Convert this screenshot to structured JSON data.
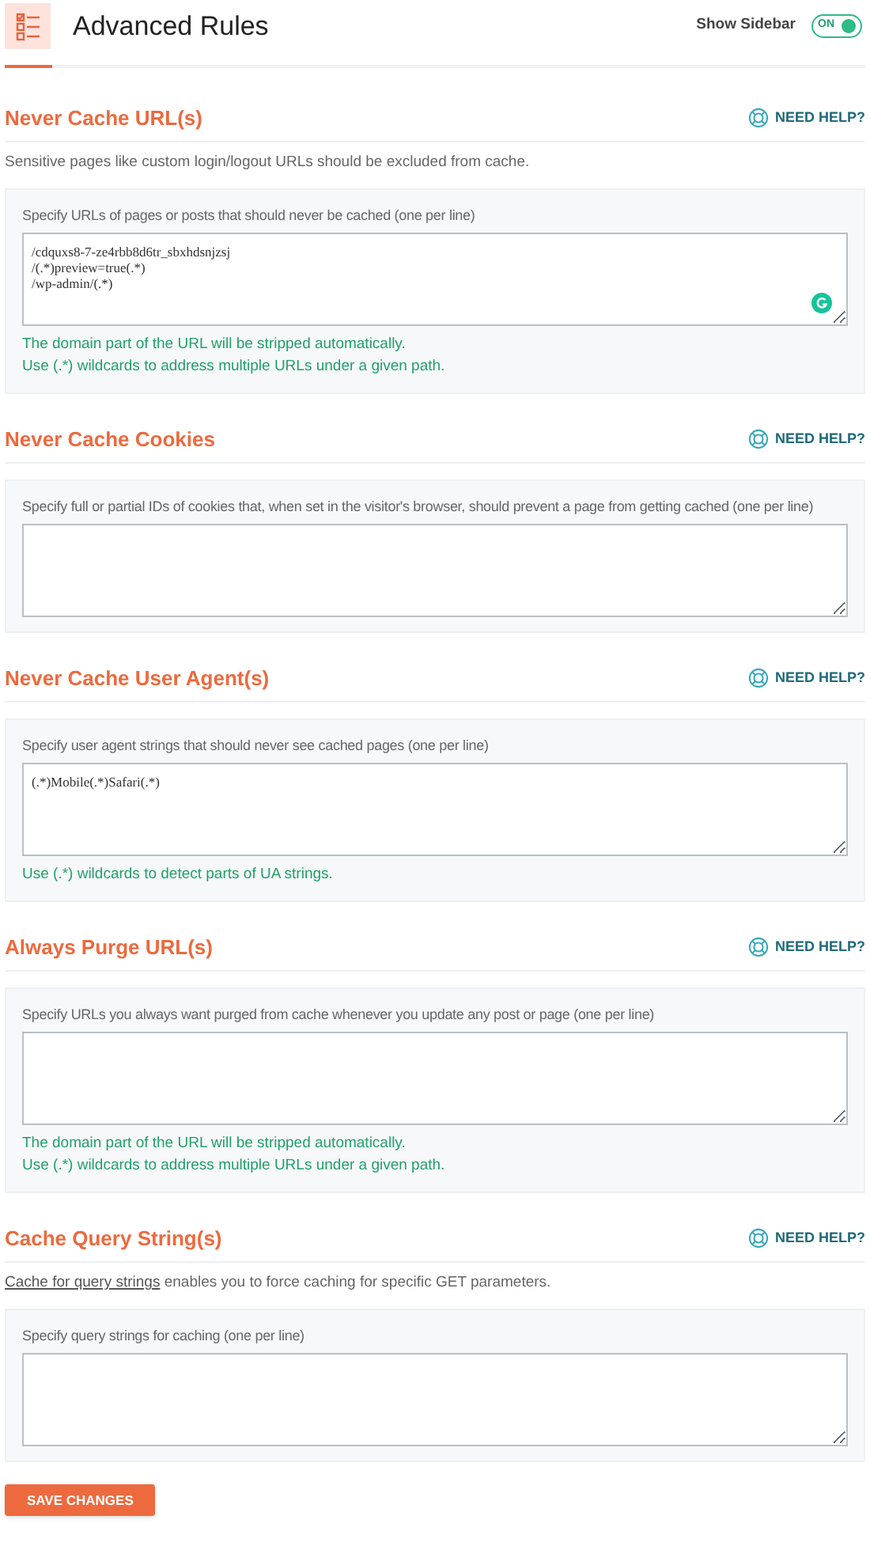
{
  "header": {
    "title": "Advanced Rules",
    "sidebar_toggle": {
      "label": "Show Sidebar",
      "state_text": "ON",
      "on": true
    }
  },
  "sections": [
    {
      "title": "Never Cache URL(s)",
      "help": "NEED HELP?",
      "description": "Sensitive pages like custom login/logout URLs should be excluded from cache.",
      "field_label": "Specify URLs of pages or posts that should never be cached (one per line)",
      "value": "/cdquxs8-7-ze4rbb8d6tr_sbxhdsnjzsj\n/(.*)preview=true(.*)\n/wp-admin/(.*)",
      "grammar_badge": true,
      "notes": [
        "The domain part of the URL will be stripped automatically.",
        "Use (.*) wildcards to address multiple URLs under a given path."
      ]
    },
    {
      "title": "Never Cache Cookies",
      "help": "NEED HELP?",
      "field_label": "Specify full or partial IDs of cookies that, when set in the visitor's browser, should prevent a page from getting cached (one per line)"
    },
    {
      "title": "Never Cache User Agent(s)",
      "help": "NEED HELP?",
      "field_label": "Specify user agent strings that should never see cached pages (one per line)",
      "value": "(.*)Mobile(.*)Safari(.*)",
      "notes": [
        "Use (.*) wildcards to detect parts of UA strings."
      ]
    },
    {
      "title": "Always Purge URL(s)",
      "help": "NEED HELP?",
      "field_label": "Specify URLs you always want purged from cache whenever you update any post or page (one per line)",
      "notes": [
        "The domain part of the URL will be stripped automatically.",
        "Use (.*) wildcards to address multiple URLs under a given path."
      ]
    },
    {
      "title": "Cache Query String(s)",
      "help": "NEED HELP?",
      "description_link": "Cache for query strings",
      "description": "enables you to force caching for specific GET parameters.",
      "field_label": "Specify query strings for caching (one per line)"
    }
  ],
  "save_button": "SAVE CHANGES"
}
